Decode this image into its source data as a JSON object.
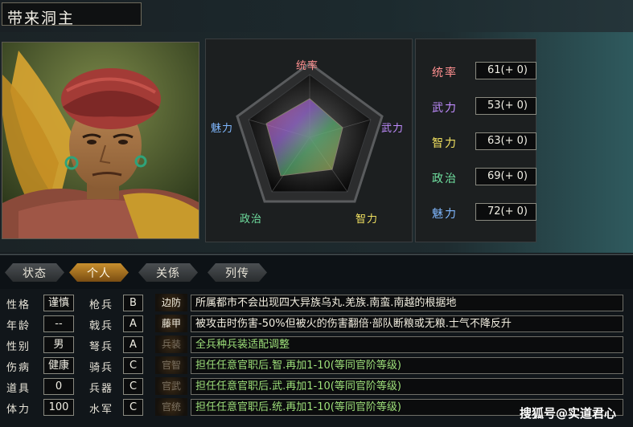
{
  "title": "带来洞主",
  "radar": {
    "top": "统率",
    "right": "武力",
    "bottom_right": "智力",
    "bottom_left": "政治",
    "left": "魅力"
  },
  "stats": [
    {
      "label": "统率",
      "value": "61(+ 0)",
      "color": "#ff9090"
    },
    {
      "label": "武力",
      "value": "53(+ 0)",
      "color": "#c08cff"
    },
    {
      "label": "智力",
      "value": "63(+ 0)",
      "color": "#f0e060"
    },
    {
      "label": "政治",
      "value": "69(+ 0)",
      "color": "#70e0a0"
    },
    {
      "label": "魅力",
      "value": "72(+ 0)",
      "color": "#80b8ff"
    }
  ],
  "tabs": [
    {
      "label": "状态",
      "active": false
    },
    {
      "label": "个人",
      "active": true
    },
    {
      "label": "关係",
      "active": false
    },
    {
      "label": "列传",
      "active": false
    }
  ],
  "personal": [
    {
      "label": "性格",
      "value": "谨慎"
    },
    {
      "label": "年龄",
      "value": "--"
    },
    {
      "label": "性别",
      "value": "男"
    },
    {
      "label": "伤病",
      "value": "健康"
    },
    {
      "label": "道具",
      "value": "0"
    },
    {
      "label": "体力",
      "value": "100"
    }
  ],
  "troops": [
    {
      "label": "枪兵",
      "grade": "B"
    },
    {
      "label": "戟兵",
      "grade": "A"
    },
    {
      "label": "弩兵",
      "grade": "A"
    },
    {
      "label": "骑兵",
      "grade": "C"
    },
    {
      "label": "兵器",
      "grade": "C"
    },
    {
      "label": "水军",
      "grade": "C"
    }
  ],
  "skills": [
    {
      "name": "边防",
      "desc": "所属都市不会出现四大异族乌丸.羌族.南蛮.南越的根据地",
      "name_color": "#f2eee0",
      "desc_color": "#f2eee0"
    },
    {
      "name": "藤甲",
      "desc": "被攻击时伤害-50%但被火的伤害翻倍·部队断粮或无粮.士气不降反升",
      "name_color": "#f2eee0",
      "desc_color": "#f2eee0"
    },
    {
      "name": "兵装",
      "desc": "全兵种兵装适配调整",
      "name_color": "#7a7060",
      "desc_color": "#9ee07a"
    },
    {
      "name": "官智",
      "desc": "担任任意官职后.智.再加1-10(等同官阶等级)",
      "name_color": "#7a7060",
      "desc_color": "#9ee07a"
    },
    {
      "name": "官武",
      "desc": "担任任意官职后.武.再加1-10(等同官阶等级)",
      "name_color": "#7a7060",
      "desc_color": "#9ee07a"
    },
    {
      "name": "官统",
      "desc": "担任任意官职后.统.再加1-10(等同官阶等级)",
      "name_color": "#7a7060",
      "desc_color": "#9ee07a"
    }
  ],
  "watermark": "搜狐号@实道君心"
}
